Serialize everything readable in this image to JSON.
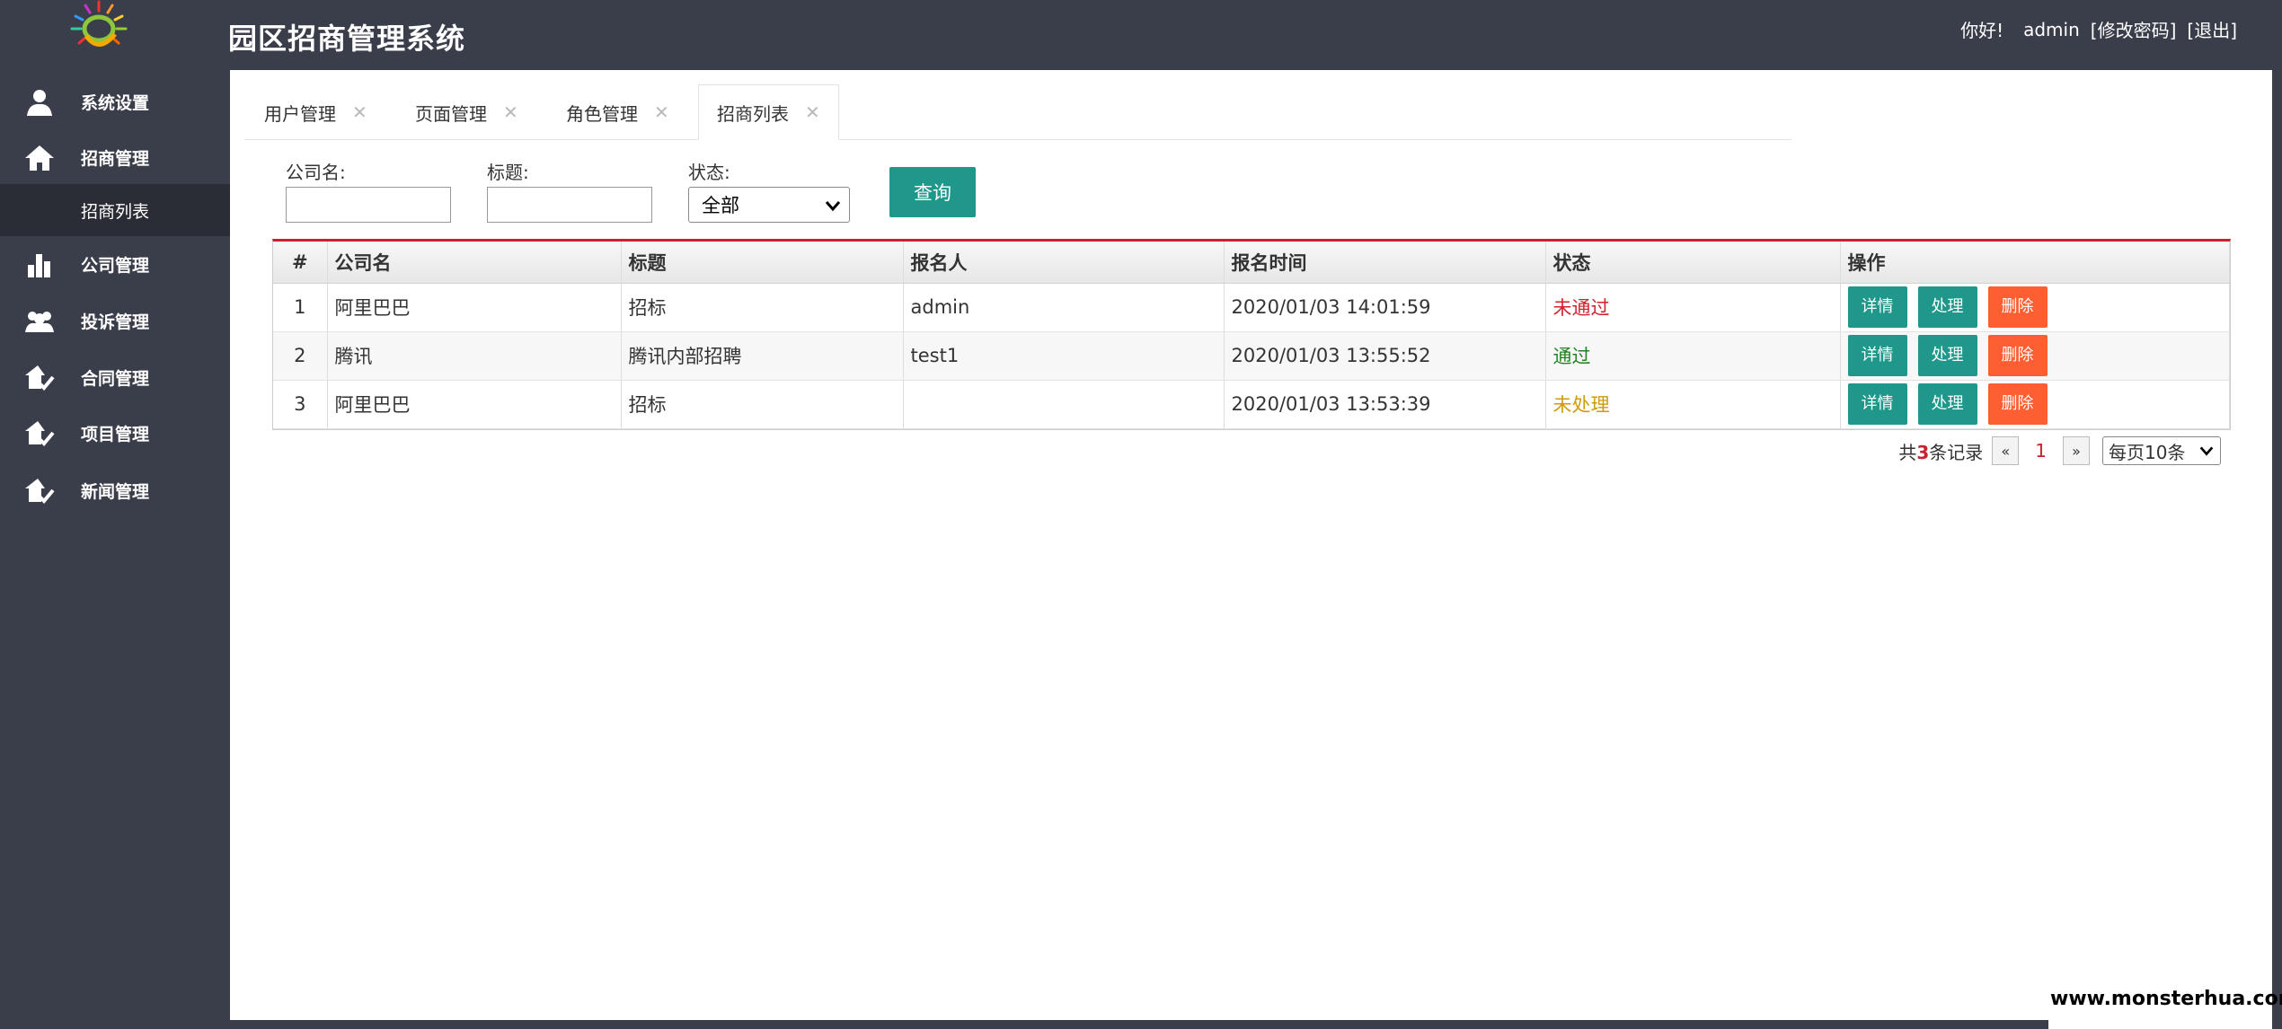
{
  "header": {
    "title": "园区招商管理系统",
    "greeting": "你好!",
    "username": "admin",
    "change_password": "[修改密码]",
    "logout": "[退出]"
  },
  "sidebar": {
    "items": [
      {
        "label": "系统设置",
        "icon": "user-icon"
      },
      {
        "label": "招商管理",
        "icon": "home-icon"
      },
      {
        "label": "公司管理",
        "icon": "bar-chart-icon"
      },
      {
        "label": "投诉管理",
        "icon": "group-icon"
      },
      {
        "label": "合同管理",
        "icon": "house-check-icon"
      },
      {
        "label": "项目管理",
        "icon": "house-check-icon"
      },
      {
        "label": "新闻管理",
        "icon": "house-check-icon"
      }
    ],
    "sub_item": "招商列表"
  },
  "tabs": [
    {
      "label": "用户管理"
    },
    {
      "label": "页面管理"
    },
    {
      "label": "角色管理"
    },
    {
      "label": "招商列表",
      "active": true
    }
  ],
  "filters": {
    "company_label": "公司名:",
    "company_value": "",
    "title_label": "标题:",
    "title_value": "",
    "status_label": "状态:",
    "status_value": "全部",
    "query_button": "查询"
  },
  "table": {
    "columns": [
      "#",
      "公司名",
      "标题",
      "报名人",
      "报名时间",
      "状态",
      "操作"
    ],
    "rows": [
      {
        "no": "1",
        "company": "阿里巴巴",
        "title": "招标",
        "applicant": "admin",
        "time": "2020/01/03 14:01:59",
        "status": "未通过",
        "status_color": "#d0222c"
      },
      {
        "no": "2",
        "company": "腾讯",
        "title": "腾讯内部招聘",
        "applicant": "test1",
        "time": "2020/01/03 13:55:52",
        "status": "通过",
        "status_color": "#218321"
      },
      {
        "no": "3",
        "company": "阿里巴巴",
        "title": "招标",
        "applicant": "",
        "time": "2020/01/03 13:53:39",
        "status": "未处理",
        "status_color": "#cf9a10"
      }
    ],
    "actions": {
      "detail": "详情",
      "handle": "处理",
      "delete": "删除"
    }
  },
  "pager": {
    "prefix": "共",
    "total": "3",
    "suffix": "条记录",
    "prev": "«",
    "current": "1",
    "next": "»",
    "page_size": "每页10条"
  },
  "watermark": "www.monsterhua.com",
  "colors": {
    "sidebar_bg": "#3a3d4a",
    "teal": "#1f978a",
    "delete_orange": "#fd5f32",
    "accent_red": "#c8222c"
  }
}
